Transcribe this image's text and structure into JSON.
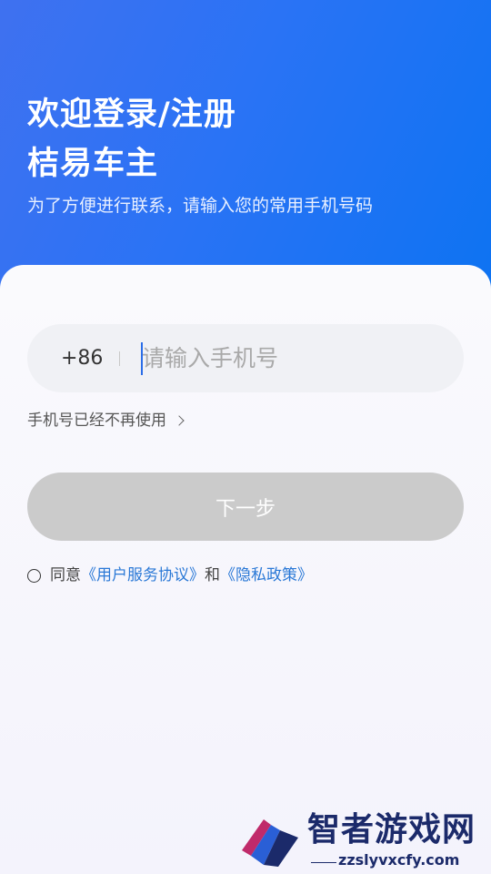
{
  "header": {
    "title_line1": "欢迎登录/注册",
    "title_line2": "桔易车主",
    "subtitle": "为了方便进行联系，请输入您的常用手机号码"
  },
  "phone": {
    "country_code": "+86",
    "placeholder": "请输入手机号",
    "value": ""
  },
  "links": {
    "no_longer_used": "手机号已经不再使用"
  },
  "next_button": {
    "label": "下一步",
    "state": "disabled"
  },
  "agreement": {
    "prefix": "同意",
    "user_agreement": "《用户服务协议》",
    "conjunction": "和",
    "privacy_policy": "《隐私政策》",
    "checked": false
  },
  "watermark": {
    "brand": "智者游戏网",
    "url": "zzslyvxcfy.com"
  },
  "colors": {
    "hero_start": "#3f71f0",
    "hero_end": "#0d73f2",
    "link": "#2a78d6",
    "button_disabled": "#cbcbcb"
  }
}
